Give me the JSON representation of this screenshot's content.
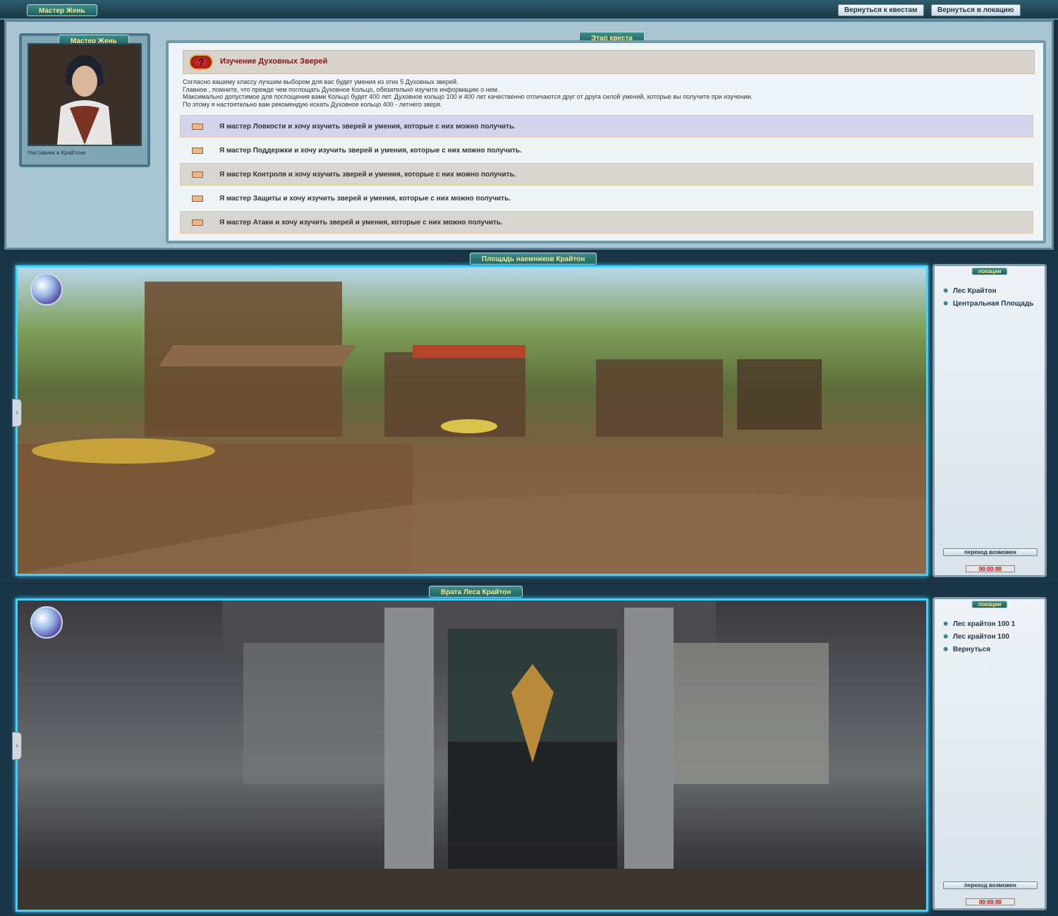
{
  "topbar": {
    "title": "Мастер Жень",
    "back_to_quests": "Вернуться к квестам",
    "back_to_location": "Вернуться в локацию"
  },
  "npc": {
    "name": "Мастер Жень",
    "caption": "Наставник в Крайтоне"
  },
  "quest": {
    "stage_label": "Этап квеста",
    "icon": "?",
    "title": "Изучение Духовных Зверей",
    "text": [
      "Согласно вашему классу лучшим выбором для вас будет умения из этих 5 Духовных зверей.",
      "Главное , помните, что прежде чем поглощать Духовное Кольцо, обязательно изучите информацию о нем.",
      "Максимально допустимое для поглощения вами Кольцо будет 400 лет. Духовное кольцо 100 и 400 лет качественно отличаются друг от друга силой умений, которые вы получите при изучении.",
      "По этому я настоятельно вам рекомендую искать Духовное кольцо 400 - летнего зверя."
    ],
    "answers": [
      "Я мастер Ловкости и хочу изучить зверей и умения, которые с них можно получить.",
      "Я мастер Поддержки и хочу изучить зверей и умения, которые с них можно получить.",
      "Я мастер Контроля и хочу изучить зверей и умения, которые с них можно получить.",
      "Я мастер Защиты и хочу изучить зверей и умения, которые с них можно получить.",
      "Я мастер Атаки и хочу изучить зверей и умения, которые с них можно получить."
    ]
  },
  "locations": [
    {
      "title": "Площадь наемников Крайтон",
      "side_label": "локации",
      "links": [
        "Лес Крайтон",
        "Центральная Площадь"
      ],
      "transit": "переход возможен",
      "timer": "00:00:00"
    },
    {
      "title": "Врата Леса Крайтон",
      "side_label": "локации",
      "links": [
        "Лес крайтон 100 1",
        "Лес крайтон 100",
        "Вернуться"
      ],
      "transit": "переход возможен",
      "timer": "00:00:00"
    }
  ]
}
